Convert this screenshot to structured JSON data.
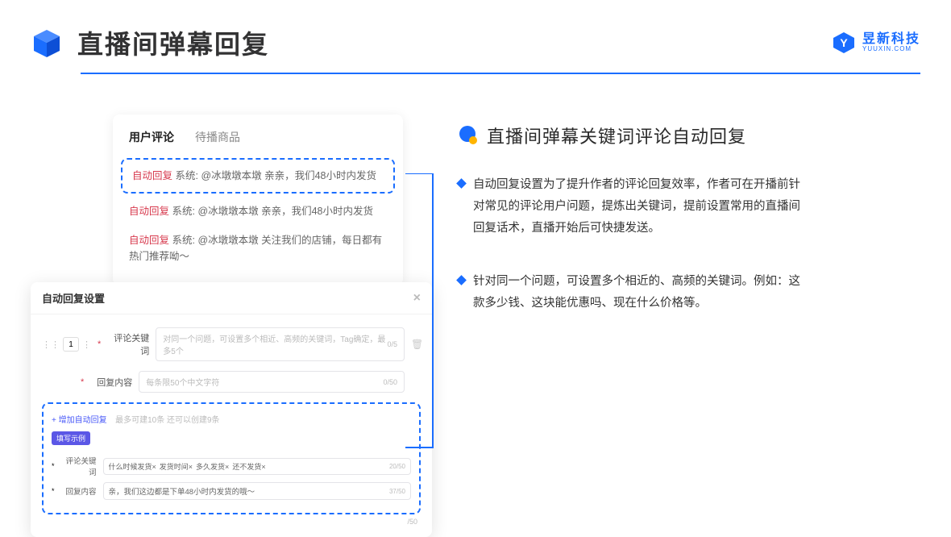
{
  "header": {
    "title": "直播间弹幕回复",
    "logo_cn": "昱新科技",
    "logo_en": "YUUXIN.COM"
  },
  "comments": {
    "tab_active": "用户评论",
    "tab_inactive": "待播商品",
    "rows": [
      {
        "tag": "自动回复",
        "text": "系统: @冰墩墩本墩 亲亲，我们48小时内发货"
      },
      {
        "tag": "自动回复",
        "text": "系统: @冰墩墩本墩 亲亲，我们48小时内发货"
      },
      {
        "tag": "自动回复",
        "text": "系统: @冰墩墩本墩 关注我们的店铺，每日都有热门推荐呦～"
      }
    ]
  },
  "settings": {
    "title": "自动回复设置",
    "order_value": "1",
    "kw_label": "评论关键词",
    "kw_placeholder": "对同一个问题，可设置多个相近、高频的关键词，Tag确定，最多5个",
    "kw_counter": "0/5",
    "reply_label": "回复内容",
    "reply_placeholder": "每条限50个中文字符",
    "reply_counter": "0/50",
    "add_link": "+ 增加自动回复",
    "add_note": "最多可建10条 还可以创建9条",
    "ex_badge": "填写示例",
    "ex_kw_label": "评论关键词",
    "ex_tags": [
      "什么时候发货×",
      "发货时间×",
      "多久发货×",
      "还不发货×"
    ],
    "ex_kw_counter": "20/50",
    "ex_reply_label": "回复内容",
    "ex_reply_text": "亲，我们这边都是下单48小时内发货的哦～",
    "ex_reply_counter": "37/50",
    "outer_counter": "/50"
  },
  "right": {
    "section_title": "直播间弹幕关键词评论自动回复",
    "bullets": [
      "自动回复设置为了提升作者的评论回复效率，作者可在开播前针对常见的评论用户问题，提炼出关键词，提前设置常用的直播间回复话术，直播开始后可快捷发送。",
      "针对同一个问题，可设置多个相近的、高频的关键词。例如：这款多少钱、这块能优惠吗、现在什么价格等。"
    ]
  }
}
